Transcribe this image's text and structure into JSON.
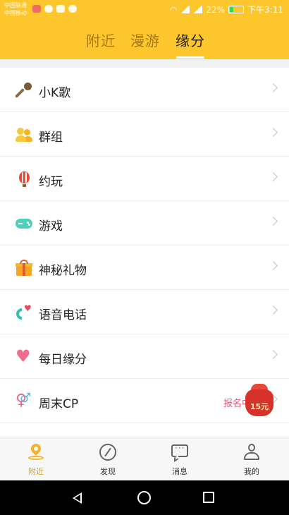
{
  "status_bar": {
    "carrier1": "中国联通",
    "carrier2": "中国移动",
    "battery": "22%",
    "time": "下午3:11"
  },
  "tabs": [
    {
      "label": "附近",
      "active": false
    },
    {
      "label": "漫游",
      "active": false
    },
    {
      "label": "缘分",
      "active": true
    }
  ],
  "menu": [
    {
      "label": "小K歌",
      "icon": "microphone-icon"
    },
    {
      "label": "群组",
      "icon": "group-icon"
    },
    {
      "label": "约玩",
      "icon": "balloon-icon"
    },
    {
      "label": "游戏",
      "icon": "gamepad-icon"
    },
    {
      "label": "神秘礼物",
      "icon": "gift-icon"
    },
    {
      "label": "语音电话",
      "icon": "phone-heart-icon"
    },
    {
      "label": "每日缘分",
      "icon": "heart-icon"
    },
    {
      "label": "周末CP",
      "icon": "gender-icon",
      "status": "报名中"
    }
  ],
  "red_packet": {
    "amount": "15元"
  },
  "bottom_nav": [
    {
      "label": "附近",
      "icon": "location-pin-icon",
      "active": true
    },
    {
      "label": "发现",
      "icon": "compass-icon",
      "active": false
    },
    {
      "label": "消息",
      "icon": "message-icon",
      "active": false
    },
    {
      "label": "我的",
      "icon": "user-icon",
      "active": false
    }
  ],
  "colors": {
    "header": "#fdc62c",
    "accent": "#d9a11e",
    "status_pink": "#e7567a"
  }
}
